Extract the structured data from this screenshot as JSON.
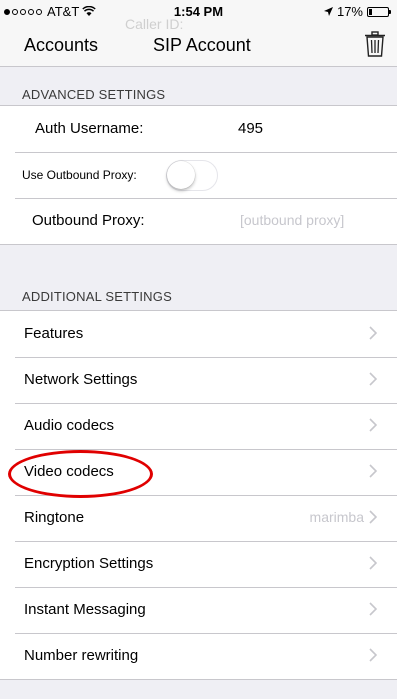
{
  "status_bar": {
    "carrier": "AT&T",
    "time": "1:54 PM",
    "battery": "17%",
    "battery_level": 0.17,
    "signal_bars_filled": 1,
    "icons": [
      "wifi-icon",
      "location-arrow-icon",
      "battery-icon"
    ]
  },
  "nav": {
    "ghost_text": "Caller ID:",
    "back_label": "Accounts",
    "title": "SIP Account",
    "trash_icon": "trash-icon"
  },
  "advanced": {
    "header": "ADVANCED SETTINGS",
    "auth_username_label": "Auth Username:",
    "auth_username_value": "495",
    "use_outbound_proxy_label": "Use Outbound Proxy:",
    "use_outbound_proxy_on": false,
    "outbound_proxy_label": "Outbound Proxy:",
    "outbound_proxy_placeholder": "[outbound proxy]"
  },
  "additional": {
    "header": "ADDITIONAL SETTINGS",
    "items": [
      {
        "label": "Features"
      },
      {
        "label": "Network Settings"
      },
      {
        "label": "Audio codecs"
      },
      {
        "label": "Video codecs"
      },
      {
        "label": "Ringtone",
        "detail": "marimba"
      },
      {
        "label": "Encryption Settings"
      },
      {
        "label": "Instant Messaging"
      },
      {
        "label": "Number rewriting"
      }
    ]
  },
  "colors": {
    "annotation_circle": "#e00000",
    "chevron": "#c7c7cc",
    "background": "#efeff4"
  }
}
